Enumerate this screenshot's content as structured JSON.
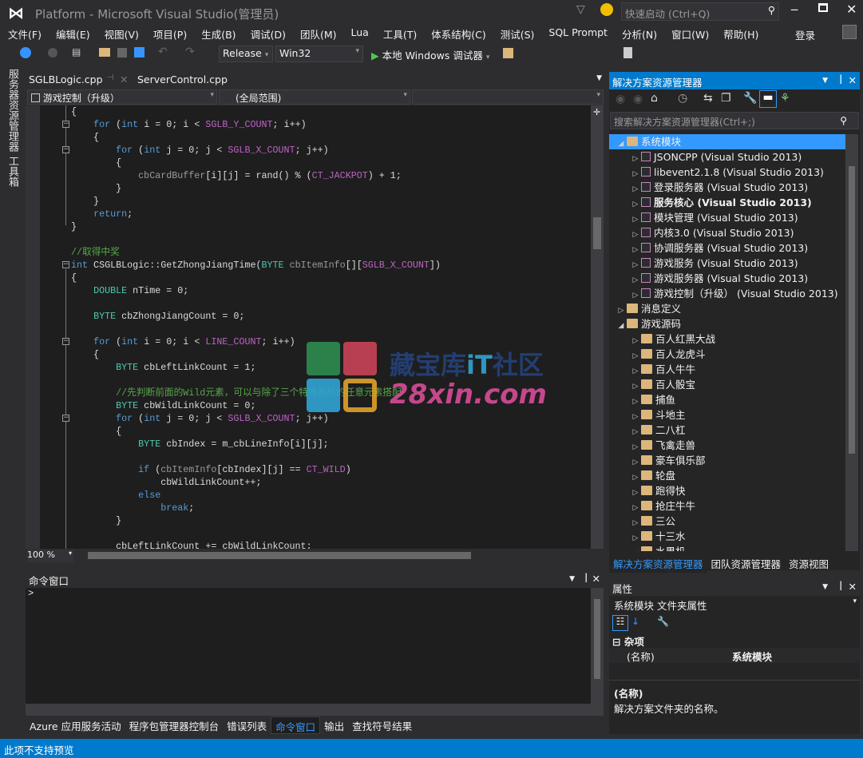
{
  "title": "Platform - Microsoft Visual Studio(管理员)",
  "quick_launch": "快速启动 (Ctrl+Q)",
  "menu": [
    "文件(F)",
    "编辑(E)",
    "视图(V)",
    "项目(P)",
    "生成(B)",
    "调试(D)",
    "团队(M)",
    "Lua",
    "工具(T)",
    "体系结构(C)",
    "测试(S)",
    "SQL Prompt",
    "分析(N)",
    "窗口(W)",
    "帮助(H)"
  ],
  "signin": "登录",
  "toolbar": {
    "config": "Release",
    "platform": "Win32",
    "debugger": "本地 Windows 调试器"
  },
  "side_tabs": [
    "服务器资源管理器",
    "工具箱"
  ],
  "doc_tabs": [
    "SGLBLogic.cpp",
    "ServerControl.cpp"
  ],
  "nav": {
    "project": "游戏控制（升级）",
    "scope": "(全局范围)",
    "member": ""
  },
  "zoom": "100 %",
  "code": [
    [
      [
        "{",
        ""
      ]
    ],
    [
      [
        "    ",
        ""
      ],
      [
        "for",
        "kw"
      ],
      [
        " (",
        ""
      ],
      [
        "int",
        "kw"
      ],
      [
        " i = 0; i < ",
        ""
      ],
      [
        "SGLB_Y_COUNT",
        "mac"
      ],
      [
        "; i++)",
        ""
      ]
    ],
    [
      [
        "    {",
        ""
      ]
    ],
    [
      [
        "        ",
        ""
      ],
      [
        "for",
        "kw"
      ],
      [
        " (",
        ""
      ],
      [
        "int",
        "kw"
      ],
      [
        " j = 0; j < ",
        ""
      ],
      [
        "SGLB_X_COUNT",
        "mac"
      ],
      [
        "; j++)",
        ""
      ]
    ],
    [
      [
        "        {",
        ""
      ]
    ],
    [
      [
        "            ",
        ""
      ],
      [
        "cbCardBuffer",
        "prm"
      ],
      [
        "[i][j] = rand() % (",
        ""
      ],
      [
        "CT_JACKPOT",
        "mac"
      ],
      [
        ") + 1;",
        ""
      ]
    ],
    [
      [
        "        }",
        ""
      ]
    ],
    [
      [
        "    }",
        ""
      ]
    ],
    [
      [
        "    ",
        ""
      ],
      [
        "return",
        "kw"
      ],
      [
        ";",
        ""
      ]
    ],
    [
      [
        "}",
        ""
      ]
    ],
    [
      [
        "",
        ""
      ]
    ],
    [
      [
        "//取得中奖",
        "cm"
      ]
    ],
    [
      [
        "int",
        "kw"
      ],
      [
        " CSGLBLogic::GetZhongJiangTime(",
        ""
      ],
      [
        "BYTE",
        "typ"
      ],
      [
        " ",
        ""
      ],
      [
        "cbItemInfo",
        "prm"
      ],
      [
        "[][",
        ""
      ],
      [
        "SGLB_X_COUNT",
        "mac"
      ],
      [
        "])",
        ""
      ]
    ],
    [
      [
        "{",
        ""
      ]
    ],
    [
      [
        "    ",
        ""
      ],
      [
        "DOUBLE",
        "typ"
      ],
      [
        " nTime = 0;",
        ""
      ]
    ],
    [
      [
        "",
        ""
      ]
    ],
    [
      [
        "    ",
        ""
      ],
      [
        "BYTE",
        "typ"
      ],
      [
        " cbZhongJiangCount = 0;",
        ""
      ]
    ],
    [
      [
        "",
        ""
      ]
    ],
    [
      [
        "    ",
        ""
      ],
      [
        "for",
        "kw"
      ],
      [
        " (",
        ""
      ],
      [
        "int",
        "kw"
      ],
      [
        " i = 0; i < ",
        ""
      ],
      [
        "LINE_COUNT",
        "mac"
      ],
      [
        "; i++)",
        ""
      ]
    ],
    [
      [
        "    {",
        ""
      ]
    ],
    [
      [
        "        ",
        ""
      ],
      [
        "BYTE",
        "typ"
      ],
      [
        " cbLeftLinkCount = 1;",
        ""
      ]
    ],
    [
      [
        "",
        ""
      ]
    ],
    [
      [
        "        ",
        ""
      ],
      [
        "//先判断前面的Wild元素，可以与除了三个特殊图标的任意元素搭配",
        "cm"
      ]
    ],
    [
      [
        "        ",
        ""
      ],
      [
        "BYTE",
        "typ"
      ],
      [
        " cbWildLinkCount = 0;",
        ""
      ]
    ],
    [
      [
        "        ",
        ""
      ],
      [
        "for",
        "kw"
      ],
      [
        " (",
        ""
      ],
      [
        "int",
        "kw"
      ],
      [
        " j = 0; j < ",
        ""
      ],
      [
        "SGLB_X_COUNT",
        "mac"
      ],
      [
        "; j++)",
        ""
      ]
    ],
    [
      [
        "        {",
        ""
      ]
    ],
    [
      [
        "            ",
        ""
      ],
      [
        "BYTE",
        "typ"
      ],
      [
        " cbIndex = m_cbLineInfo[i][j];",
        ""
      ]
    ],
    [
      [
        "",
        ""
      ]
    ],
    [
      [
        "            ",
        ""
      ],
      [
        "if",
        "kw"
      ],
      [
        " (",
        ""
      ],
      [
        "cbItemInfo",
        "prm"
      ],
      [
        "[cbIndex][j] == ",
        ""
      ],
      [
        "CT_WILD",
        "mac"
      ],
      [
        ")",
        ""
      ]
    ],
    [
      [
        "                cbWildLinkCount++;",
        ""
      ]
    ],
    [
      [
        "            ",
        ""
      ],
      [
        "else",
        "kw"
      ]
    ],
    [
      [
        "                ",
        ""
      ],
      [
        "break",
        "kw"
      ],
      [
        ";",
        ""
      ]
    ],
    [
      [
        "        }",
        ""
      ]
    ],
    [
      [
        "",
        ""
      ]
    ],
    [
      [
        "        cbLeftLinkCount += cbWildLinkCount;",
        ""
      ]
    ]
  ],
  "watermark": {
    "line1": "藏宝库IT社区",
    "line2": "28xin.com"
  },
  "command_window": {
    "title": "命令窗口",
    "prompt": ">"
  },
  "bottom_tabs": [
    "Azure 应用服务活动",
    "程序包管理器控制台",
    "错误列表",
    "命令窗口",
    "输出",
    "查找符号结果"
  ],
  "bottom_active": 3,
  "status": "此项不支持预览",
  "solution_explorer": {
    "title": "解决方案资源管理器",
    "search_placeholder": "搜索解决方案资源管理器(Ctrl+;)",
    "items": [
      {
        "label": "系统模块",
        "level": 0,
        "type": "folder",
        "state": "expanded",
        "selected": true
      },
      {
        "label": "JSONCPP (Visual Studio 2013)",
        "level": 1,
        "type": "project",
        "state": "collapsed"
      },
      {
        "label": "libevent2.1.8 (Visual Studio 2013)",
        "level": 1,
        "type": "project",
        "state": "collapsed"
      },
      {
        "label": "登录服务器 (Visual Studio 2013)",
        "level": 1,
        "type": "project",
        "state": "collapsed"
      },
      {
        "label": "服务核心 (Visual Studio 2013)",
        "level": 1,
        "type": "project",
        "state": "collapsed",
        "bold": true
      },
      {
        "label": "模块管理 (Visual Studio 2013)",
        "level": 1,
        "type": "project",
        "state": "collapsed"
      },
      {
        "label": "内核3.0 (Visual Studio 2013)",
        "level": 1,
        "type": "project",
        "state": "collapsed"
      },
      {
        "label": "协调服务器 (Visual Studio 2013)",
        "level": 1,
        "type": "project",
        "state": "collapsed"
      },
      {
        "label": "游戏服务 (Visual Studio 2013)",
        "level": 1,
        "type": "project",
        "state": "collapsed"
      },
      {
        "label": "游戏服务器 (Visual Studio 2013)",
        "level": 1,
        "type": "project",
        "state": "collapsed"
      },
      {
        "label": "游戏控制（升级） (Visual Studio 2013)",
        "level": 1,
        "type": "project",
        "state": "collapsed"
      },
      {
        "label": "消息定义",
        "level": 0,
        "type": "folder",
        "state": "collapsed"
      },
      {
        "label": "游戏源码",
        "level": 0,
        "type": "folder",
        "state": "expanded"
      },
      {
        "label": "百人红黑大战",
        "level": 1,
        "type": "folder",
        "state": "collapsed"
      },
      {
        "label": "百人龙虎斗",
        "level": 1,
        "type": "folder",
        "state": "collapsed"
      },
      {
        "label": "百人牛牛",
        "level": 1,
        "type": "folder",
        "state": "collapsed"
      },
      {
        "label": "百人骰宝",
        "level": 1,
        "type": "folder",
        "state": "collapsed"
      },
      {
        "label": "捕鱼",
        "level": 1,
        "type": "folder",
        "state": "collapsed"
      },
      {
        "label": "斗地主",
        "level": 1,
        "type": "folder",
        "state": "collapsed"
      },
      {
        "label": "二八杠",
        "level": 1,
        "type": "folder",
        "state": "collapsed"
      },
      {
        "label": "飞禽走兽",
        "level": 1,
        "type": "folder",
        "state": "collapsed"
      },
      {
        "label": "豪车俱乐部",
        "level": 1,
        "type": "folder",
        "state": "collapsed"
      },
      {
        "label": "轮盘",
        "level": 1,
        "type": "folder",
        "state": "collapsed"
      },
      {
        "label": "跑得快",
        "level": 1,
        "type": "folder",
        "state": "collapsed"
      },
      {
        "label": "抢庄牛牛",
        "level": 1,
        "type": "folder",
        "state": "collapsed"
      },
      {
        "label": "三公",
        "level": 1,
        "type": "folder",
        "state": "collapsed"
      },
      {
        "label": "十三水",
        "level": 1,
        "type": "folder",
        "state": "collapsed"
      },
      {
        "label": "水果机",
        "level": 1,
        "type": "folder",
        "state": "expanded"
      }
    ],
    "tabs": [
      "解决方案资源管理器",
      "团队资源管理器",
      "资源视图"
    ]
  },
  "properties": {
    "title": "属性",
    "object": "系统模块",
    "object_type": "文件夹属性",
    "category": "杂项",
    "prop_name": "(名称)",
    "prop_value": "系统模块",
    "desc_title": "(名称)",
    "desc_text": "解决方案文件夹的名称。"
  },
  "colors": {
    "accent": "#007acc",
    "background": "#2d2d30",
    "editor": "#1e1e1e",
    "selection": "#3399ff"
  }
}
